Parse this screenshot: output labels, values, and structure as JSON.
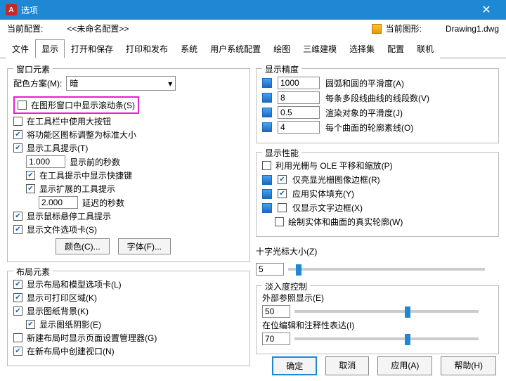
{
  "titlebar": {
    "icon": "A",
    "title": "选项",
    "close": "✕"
  },
  "info": {
    "profile_label": "当前配置:",
    "profile_value": "<<未命名配置>>",
    "drawing_label": "当前图形:",
    "drawing_value": "Drawing1.dwg"
  },
  "tabs": [
    "文件",
    "显示",
    "打开和保存",
    "打印和发布",
    "系统",
    "用户系统配置",
    "绘图",
    "三维建模",
    "选择集",
    "配置",
    "联机"
  ],
  "active_tab": 1,
  "left": {
    "window_group": "窗口元素",
    "scheme_label": "配色方案(M):",
    "scheme_value": "暗",
    "scrollbar": "在图形窗口中显示滚动条(S)",
    "bigbtn": "在工具栏中使用大按钮",
    "stdicon": "将功能区图标调整为标准大小",
    "tooltip": "显示工具提示(T)",
    "tooltip_sec_val": "1.000",
    "tooltip_sec_lbl": "显示前的秒数",
    "shortcut": "在工具提示中显示快捷键",
    "ext_tooltip": "显示扩展的工具提示",
    "delay_val": "2.000",
    "delay_lbl": "延迟的秒数",
    "hover": "显示鼠标悬停工具提示",
    "filetab": "显示文件选项卡(S)",
    "color_btn": "颜色(C)...",
    "font_btn": "字体(F)...",
    "layout_group": "布局元素",
    "layout_tabs": "显示布局和模型选项卡(L)",
    "printable": "显示可打印区域(K)",
    "paper_bg": "显示图纸背景(K)",
    "paper_shadow": "显示图纸阴影(E)",
    "newlayout": "新建布局时显示页面设置管理器(G)",
    "viewport": "在新布局中创建视口(N)"
  },
  "right": {
    "precision_group": "显示精度",
    "p1_val": "1000",
    "p1_lbl": "圆弧和圆的平滑度(A)",
    "p2_val": "8",
    "p2_lbl": "每条多段线曲线的线段数(V)",
    "p3_val": "0.5",
    "p3_lbl": "渲染对象的平滑度(J)",
    "p4_val": "4",
    "p4_lbl": "每个曲面的轮廓素线(O)",
    "perf_group": "显示性能",
    "perf1": "利用光栅与 OLE 平移和缩放(P)",
    "perf2": "仅亮显光栅图像边框(R)",
    "perf3": "应用实体填充(Y)",
    "perf4": "仅显示文字边框(X)",
    "perf5": "绘制实体和曲面的真实轮廓(W)",
    "cross_label": "十字光标大小(Z)",
    "cross_val": "5",
    "fade_group": "淡入度控制",
    "fade1_lbl": "外部参照显示(E)",
    "fade1_val": "50",
    "fade2_lbl": "在位编辑和注释性表达(I)",
    "fade2_val": "70"
  },
  "footer": {
    "ok": "确定",
    "cancel": "取消",
    "apply": "应用(A)",
    "help": "帮助(H)"
  }
}
